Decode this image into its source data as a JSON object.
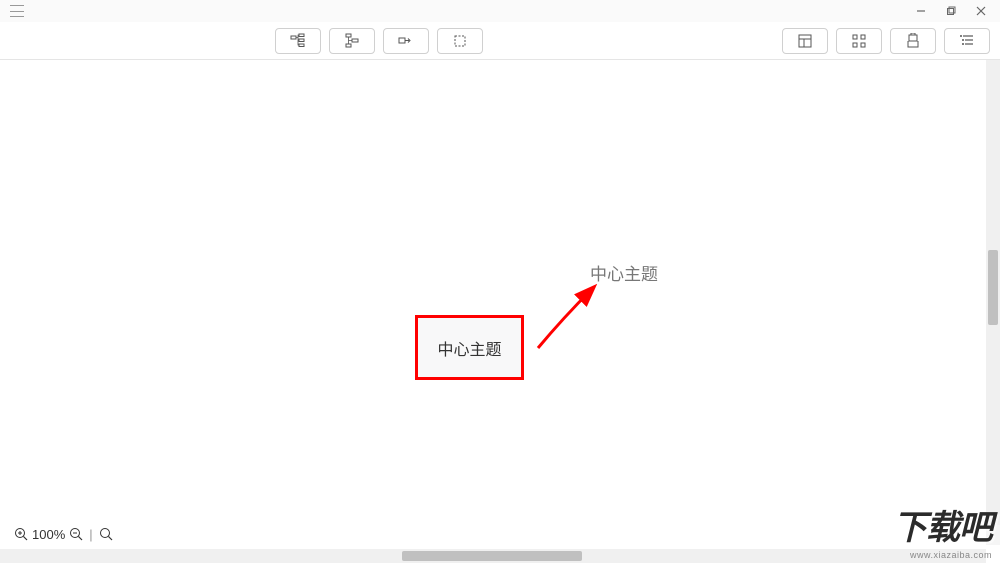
{
  "window": {
    "minimize": "—",
    "maximize": "❐",
    "close": "✕"
  },
  "toolbar": {
    "center_buttons": [
      {
        "name": "insert-subtopic",
        "icon": "subtopic"
      },
      {
        "name": "insert-topic",
        "icon": "topic"
      },
      {
        "name": "relationship",
        "icon": "relation"
      },
      {
        "name": "boundary",
        "icon": "boundary"
      }
    ],
    "right_buttons": [
      {
        "name": "layout",
        "icon": "layout"
      },
      {
        "name": "structure",
        "icon": "structure"
      },
      {
        "name": "style",
        "icon": "style"
      },
      {
        "name": "outline",
        "icon": "outline"
      }
    ]
  },
  "canvas": {
    "central_topic": "中心主题",
    "secondary_topic": "中心主题"
  },
  "statusbar": {
    "zoom_level": "100%"
  },
  "watermark": {
    "main": "下载吧",
    "url": "www.xiazaiba.com"
  }
}
